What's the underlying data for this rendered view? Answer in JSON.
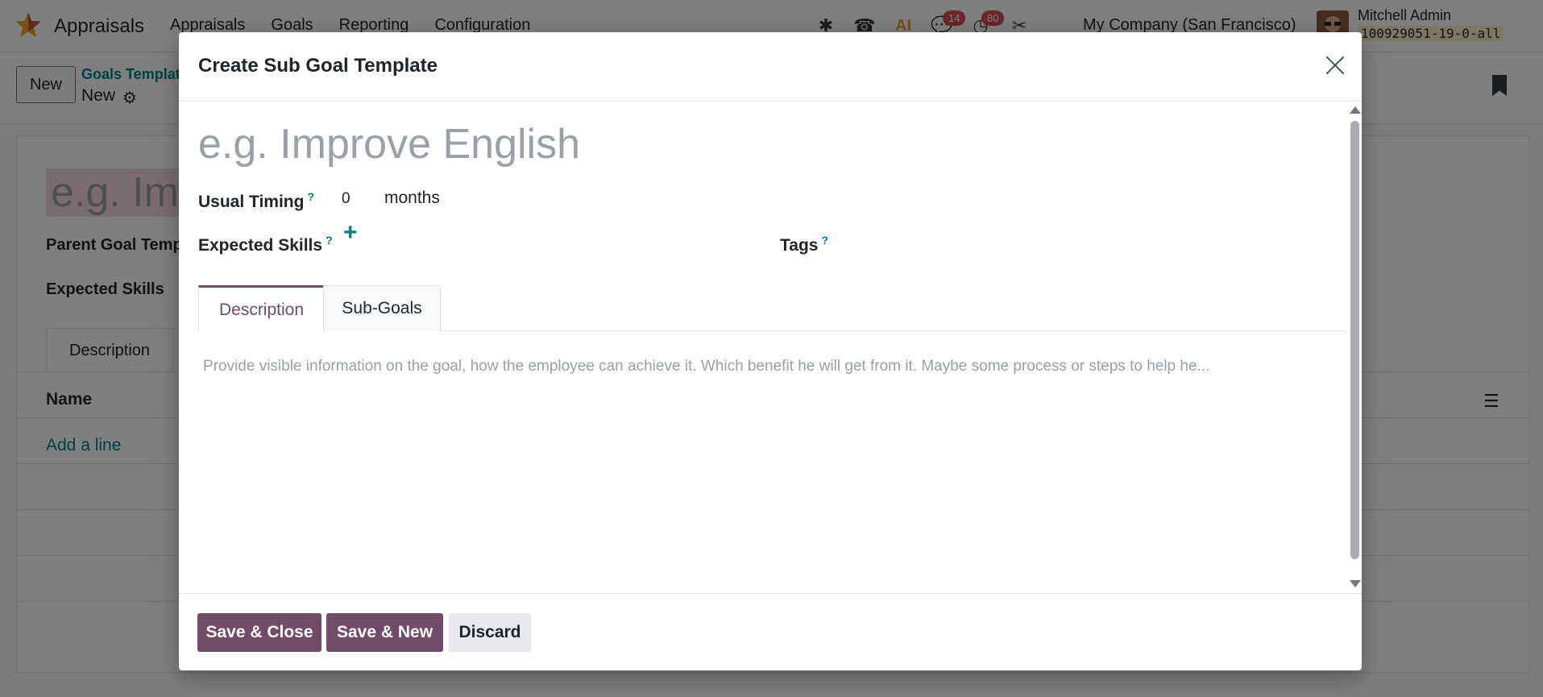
{
  "navbar": {
    "app_name": "Appraisals",
    "menu": [
      "Appraisals",
      "Goals",
      "Reporting",
      "Configuration"
    ],
    "badges": {
      "messages": "14",
      "activities": "80"
    },
    "ai_label": "AI",
    "company": "My Company (San Francisco)",
    "user_name": "Mitchell Admin",
    "database": "100929051-19-0-all"
  },
  "control_panel": {
    "new_label": "New",
    "breadcrumb_parent": "Goals Templat",
    "breadcrumb_current": "New"
  },
  "background_form": {
    "title_placeholder": "e.g. Imp",
    "parent_label": "Parent Goal Temp",
    "skills_label": "Expected Skills",
    "tab_label": "Description",
    "column_name": "Name",
    "add_line": "Add a line"
  },
  "modal": {
    "title": "Create Sub Goal Template",
    "name_placeholder": "e.g. Improve English",
    "usual_timing_label": "Usual Timing",
    "usual_timing_help": "?",
    "usual_timing_value": "0",
    "usual_timing_unit": "months",
    "expected_skills_label": "Expected Skills",
    "expected_skills_help": "?",
    "tags_label": "Tags",
    "tags_help": "?",
    "tabs": [
      {
        "label": "Description",
        "active": true
      },
      {
        "label": "Sub-Goals",
        "active": false
      }
    ],
    "description_placeholder": "Provide visible information on the goal, how the employee can achieve it. Which benefit he will get from it. Maybe some process or steps to help he...",
    "buttons": {
      "save_close": "Save & Close",
      "save_new": "Save & New",
      "discard": "Discard"
    }
  },
  "colors": {
    "primary": "#714b67",
    "link": "#017e84",
    "badge": "#d44c59"
  }
}
